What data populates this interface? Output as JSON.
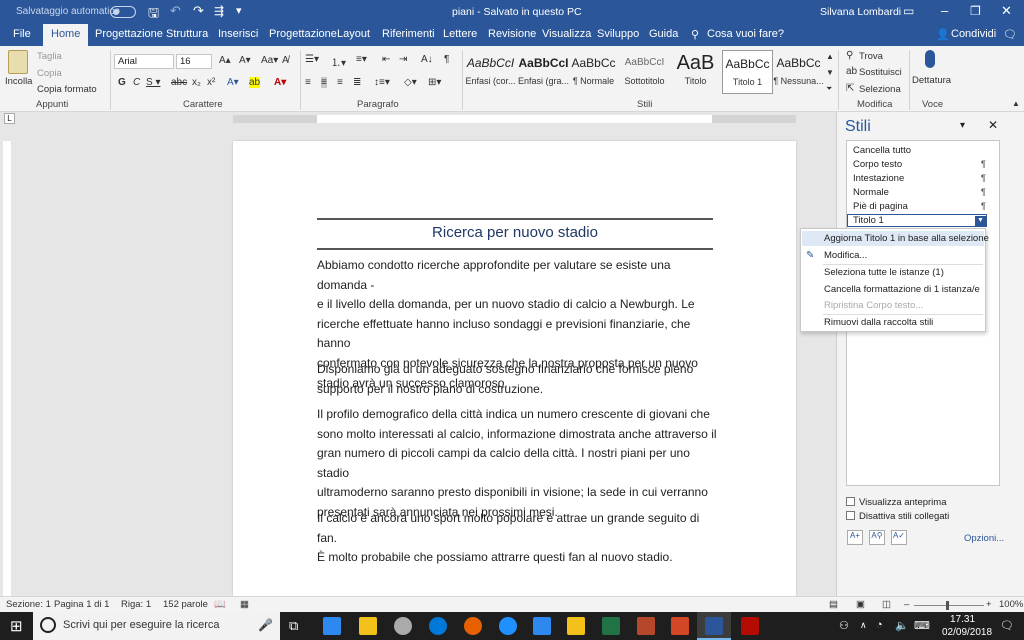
{
  "titlebar": {
    "autosave": "Salvataggio automatico",
    "autosave_state": "off",
    "doc_title": "piani  -  Salvato in questo PC",
    "user": "Silvana Lombardi"
  },
  "tabs": [
    "File",
    "Home",
    "Progettazione",
    "Struttura",
    "Inserisci",
    "Progettazione",
    "Layout",
    "Riferimenti",
    "Lettere",
    "Revisione",
    "Visualizza",
    "Sviluppo",
    "Guida"
  ],
  "tell_me": "Cosa vuoi fare?",
  "share": "Condividi",
  "clipboard": {
    "paste": "Incolla",
    "cut": "Taglia",
    "copy": "Copia",
    "format_painter": "Copia formato",
    "label": "Appunti"
  },
  "font": {
    "name": "Arial",
    "size": "16",
    "label": "Carattere"
  },
  "paragraph": {
    "label": "Paragrafo"
  },
  "styles": {
    "label": "Stili",
    "gallery": [
      {
        "preview": "AaBbCcI",
        "name": "Enfasi (cor..."
      },
      {
        "preview": "AaBbCcI",
        "name": "Enfasi (gra..."
      },
      {
        "preview": "AaBbCc",
        "name": "¶ Normale"
      },
      {
        "preview": "AaBbCcI",
        "name": "Sottotitolo"
      },
      {
        "preview": "AaB",
        "name": "Titolo"
      },
      {
        "preview": "AaBbCc",
        "name": "Titolo 1"
      },
      {
        "preview": "AaBbCc",
        "name": "¶ Nessuna..."
      }
    ]
  },
  "editing": {
    "find": "Trova",
    "replace": "Sostituisci",
    "select": "Seleziona",
    "label": "Modifica"
  },
  "voice": {
    "dictate": "Dettatura",
    "label": "Voce"
  },
  "document": {
    "heading": "Ricerca per nuovo stadio",
    "paragraphs": [
      "Abbiamo condotto ricerche approfondite per valutare se esiste una domanda -\ne il livello della domanda, per un nuovo stadio di calcio a Newburgh. Le\nricerche effettuate hanno incluso sondaggi e previsioni finanziarie, che hanno\nconfermato con notevole sicurezza che la nostra proposta per un nuovo\nstadio avrà un successo clamoroso.",
      "Disponiamo già di un adeguato sostegno finanziario che fornisce pieno\nsupporto per il nostro piano di costruzione.",
      "Il profilo demografico della città indica un numero crescente di giovani che\nsono molto interessati al calcio, informazione dimostrata anche attraverso il\ngran numero di piccoli campi da calcio della città. I nostri piani per uno stadio\nultramoderno saranno presto disponibili in visione; la sede in cui verranno\npresentati sarà annunciata nei prossimi mesi.",
      "Il calcio è ancora uno sport molto popolare e attrae un grande seguito di fan.\nÈ molto probabile che possiamo attrarre questi fan al nuovo stadio."
    ]
  },
  "styles_pane": {
    "title": "Stili",
    "items": [
      {
        "name": "Cancella tutto",
        "mark": ""
      },
      {
        "name": "Corpo testo",
        "mark": "¶"
      },
      {
        "name": "Intestazione",
        "mark": "¶"
      },
      {
        "name": "Normale",
        "mark": "¶"
      },
      {
        "name": "Piè di pagina",
        "mark": "¶"
      },
      {
        "name": "Titolo 1",
        "mark": ""
      }
    ],
    "show_preview": "Visualizza anteprima",
    "disable_linked": "Disattiva stili collegati",
    "options": "Opzioni..."
  },
  "context_menu": {
    "items": [
      "Aggiorna Titolo 1 in base alla selezione",
      "Modifica...",
      "Seleziona tutte le istanze (1)",
      "Cancella formattazione di 1 istanza/e",
      "Ripristina Corpo testo...",
      "Rimuovi dalla raccolta stili"
    ]
  },
  "status": {
    "section": "Sezione: 1",
    "page": "Pagina 1 di 1",
    "line": "Riga: 1",
    "words": "152 parole",
    "zoom": "100%"
  },
  "taskbar": {
    "search": "Scrivi qui per eseguire la ricerca",
    "time": "17.31",
    "date": "02/09/2018"
  },
  "colors": {
    "word_blue": "#2b579a",
    "heading_blue": "#1f3864"
  }
}
